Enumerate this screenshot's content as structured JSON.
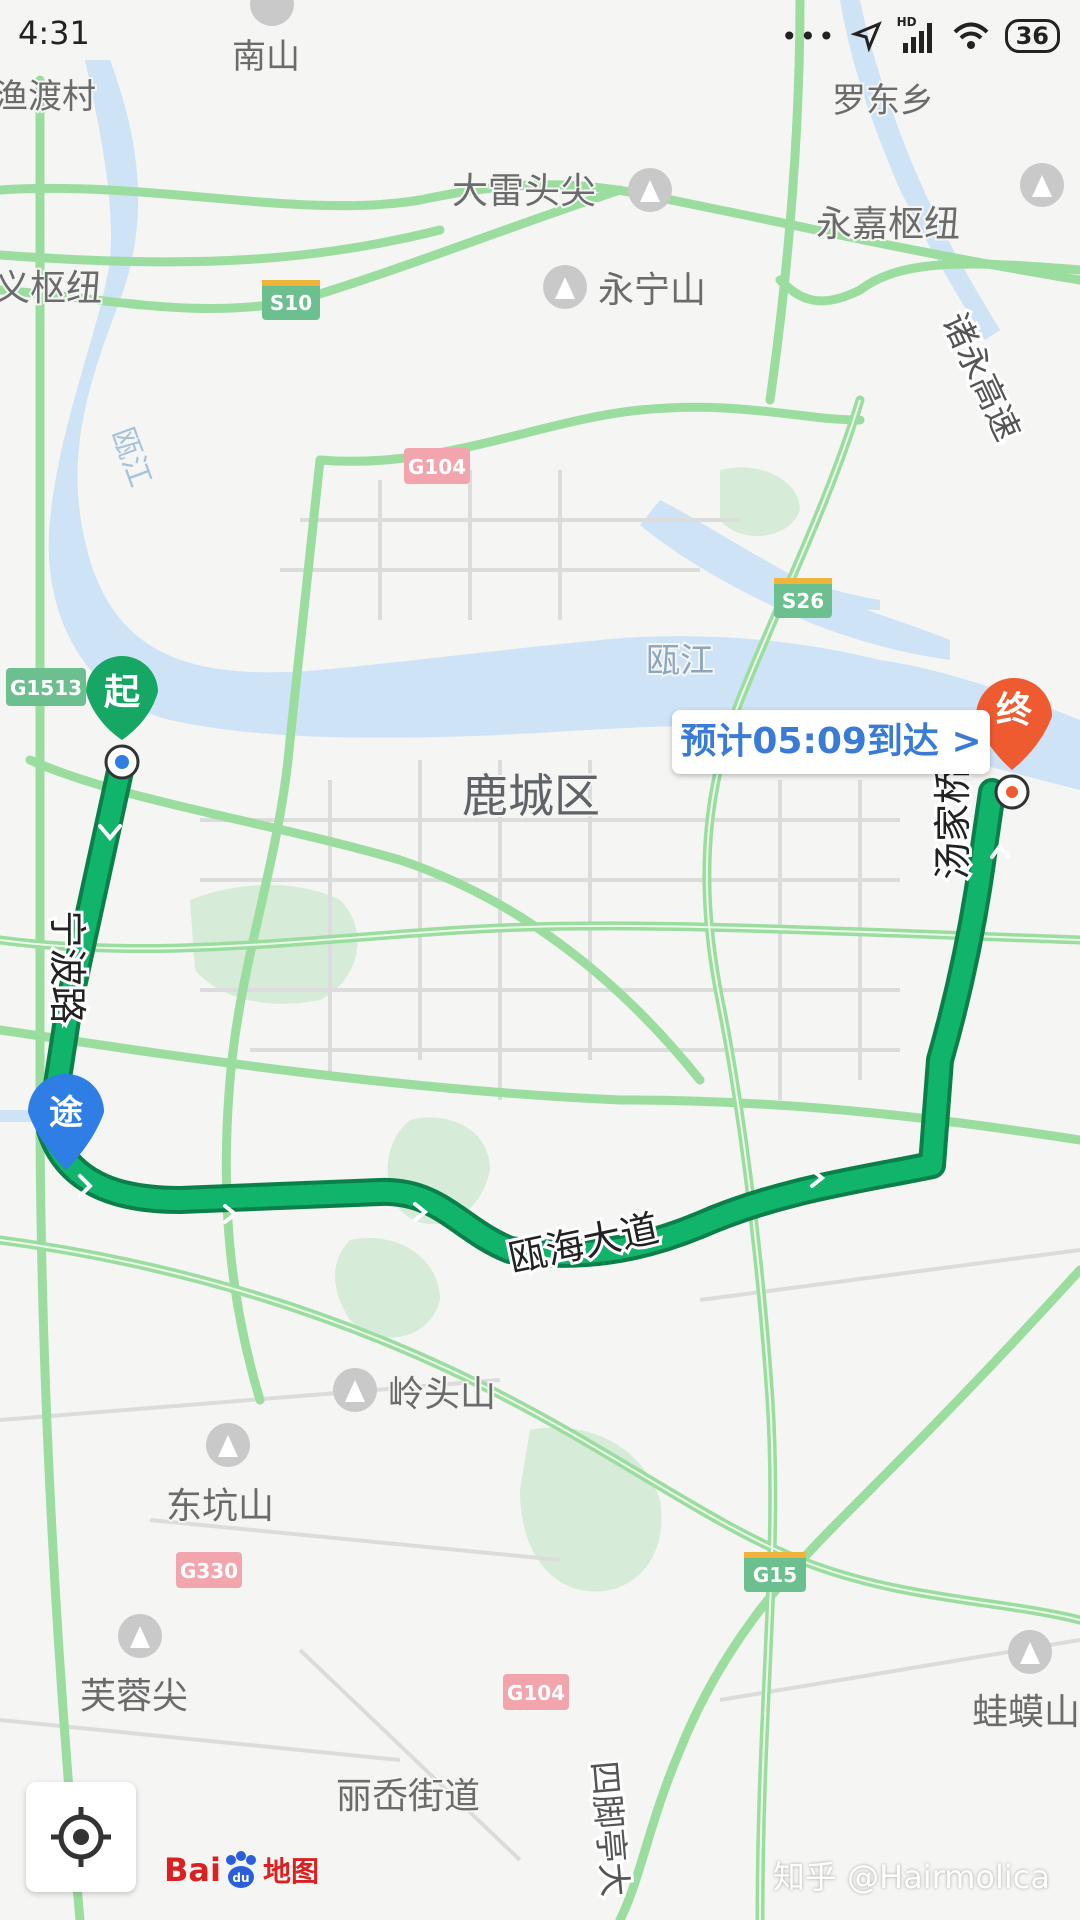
{
  "status_bar": {
    "time": "4:31",
    "network": "HD",
    "battery": "36"
  },
  "map": {
    "districts": [
      {
        "name": "鹿城区"
      }
    ],
    "places": [
      "南山",
      "渔渡村",
      "罗东乡",
      "大雷头尖",
      "永嘉枢纽",
      "义枢纽",
      "永宁山",
      "瓯江",
      "瓯江",
      "岭头山",
      "东坑山",
      "芙蓉尖",
      "丽岙街道",
      "蛙蟆山"
    ],
    "mountain_pois": [
      "大雷头尖",
      "永宁山",
      "岭头山",
      "东坑山",
      "芙蓉尖",
      "蛙蟆山"
    ],
    "road_shields": [
      {
        "label": "S10",
        "type": "expressway"
      },
      {
        "label": "G104",
        "type": "national"
      },
      {
        "label": "S26",
        "type": "expressway"
      },
      {
        "label": "G1513",
        "type": "expressway"
      },
      {
        "label": "G330",
        "type": "national"
      },
      {
        "label": "G15",
        "type": "expressway"
      },
      {
        "label": "G104",
        "type": "national"
      }
    ],
    "road_names": [
      "宁波路",
      "瓯海大道",
      "汤家桥路",
      "诸永高速",
      "四脚亭大"
    ],
    "route": {
      "start_marker": "起",
      "waypoint_marker": "途",
      "end_marker": "终",
      "eta_label": "预计05:09到达 >",
      "color": "#10b46b"
    }
  },
  "controls": {
    "locate_icon": "locate-crosshair-icon"
  },
  "branding": {
    "logo_bai": "Bai",
    "logo_ditu": "地图"
  },
  "watermark": "知乎 @Hairmolica",
  "colors": {
    "background": "#f5f5f3",
    "water": "#cfe3f7",
    "green_area": "#d6ecd8",
    "road_casing": "#9bdd9f",
    "route": "#10b46b",
    "start": "#16a765",
    "waypoint": "#2f7ee6",
    "end": "#ef5b30"
  }
}
